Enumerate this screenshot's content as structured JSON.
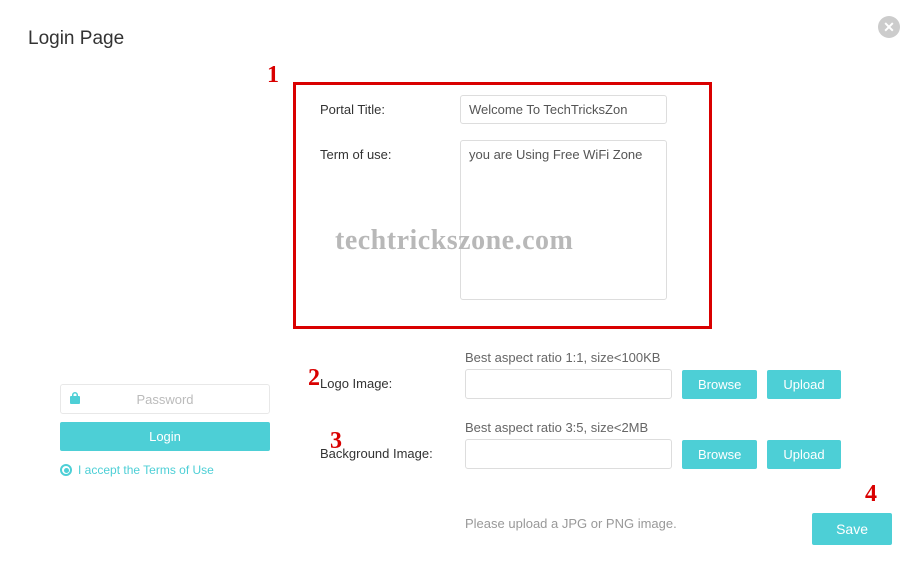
{
  "page": {
    "title": "Login Page"
  },
  "annotations": {
    "n1": "1",
    "n2": "2",
    "n3": "3",
    "n4": "4"
  },
  "form": {
    "portal_title_label": "Portal Title:",
    "portal_title_value": "Welcome To TechTricksZon",
    "terms_label": "Term of use:",
    "terms_value": "you are Using Free WiFi Zone"
  },
  "logo": {
    "label": "Logo Image:",
    "hint": "Best aspect ratio 1:1, size<100KB",
    "browse": "Browse",
    "upload": "Upload"
  },
  "background": {
    "label": "Background Image:",
    "hint": "Best aspect ratio 3:5, size<2MB",
    "browse": "Browse",
    "upload": "Upload"
  },
  "upload_note": "Please upload a JPG or PNG image.",
  "save_label": "Save",
  "preview": {
    "password_placeholder": "Password",
    "login_label": "Login",
    "accept_prefix": "I accept the ",
    "terms_link": "Terms of Use"
  },
  "watermark": "techtrickszone.com"
}
